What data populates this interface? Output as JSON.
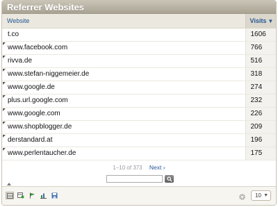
{
  "widget": {
    "title": "Referrer Websites"
  },
  "table": {
    "label_header": "Website",
    "value_header": "Visits",
    "rows": [
      {
        "label": "t.co",
        "value": "1606"
      },
      {
        "label": "www.facebook.com",
        "value": "766"
      },
      {
        "label": "rivva.de",
        "value": "516"
      },
      {
        "label": "www.stefan-niggemeier.de",
        "value": "318"
      },
      {
        "label": "www.google.de",
        "value": "274"
      },
      {
        "label": "plus.url.google.com",
        "value": "232"
      },
      {
        "label": "www.google.com",
        "value": "226"
      },
      {
        "label": "www.shopblogger.de",
        "value": "209"
      },
      {
        "label": "derstandard.at",
        "value": "196"
      },
      {
        "label": "www.perlentaucher.de",
        "value": "175"
      }
    ]
  },
  "pagination": {
    "range": "1–10 of 373",
    "next": "Next ›"
  },
  "footer": {
    "limit": "10",
    "icons": [
      "table-icon",
      "table-more-icon",
      "flag-icon",
      "bar-chart-icon",
      "export-icon",
      "gear-icon"
    ]
  },
  "colors": {
    "header_bg": "#b9b3a4",
    "link_blue": "#255792",
    "value_col_bg": "#f3f2ee"
  }
}
